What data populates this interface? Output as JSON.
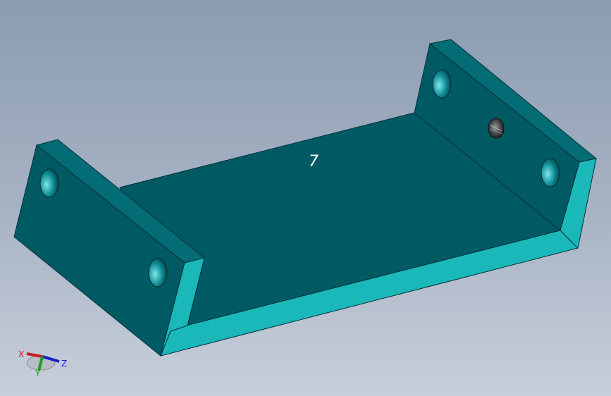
{
  "viewport": {
    "background_top": "#8c9bb0",
    "background_bottom": "#c8cfda"
  },
  "model": {
    "face_color": "#005a64",
    "side_color": "#1ab8b8",
    "hole_color": "#0a7e86",
    "annotation": "7"
  },
  "triad": {
    "x_label": "X",
    "y_label": "Y",
    "z_label": "Z",
    "x_color": "#c81e1e",
    "y_color": "#1e9e1e",
    "z_color": "#1e1ec8"
  }
}
